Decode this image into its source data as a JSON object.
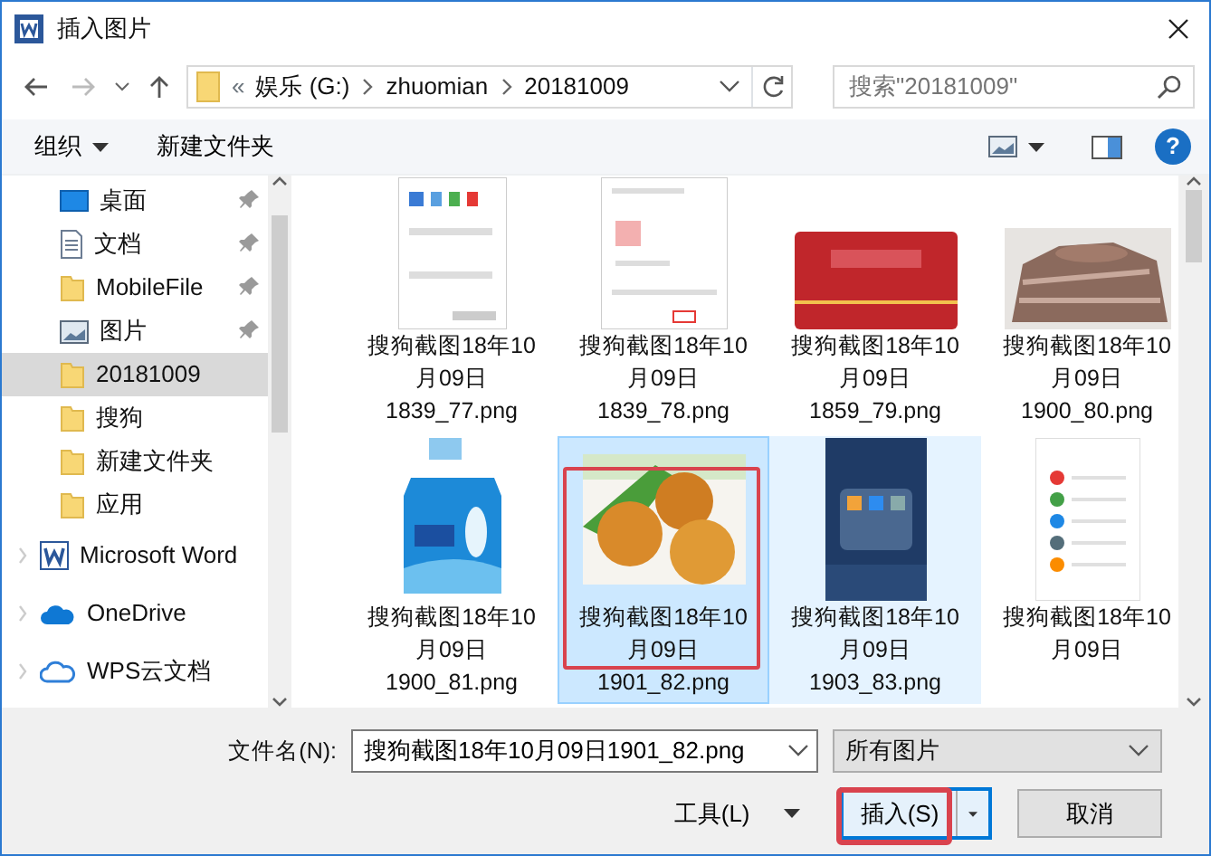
{
  "window": {
    "title": "插入图片"
  },
  "address_bar": {
    "overflow": "«",
    "crumbs": [
      "娱乐 (G:)",
      "zhuomian",
      "20181009"
    ]
  },
  "nav": {
    "back_disabled": false,
    "forward_disabled": true
  },
  "search": {
    "placeholder": "搜索\"20181009\""
  },
  "toolbar": {
    "organize": "组织",
    "new_folder": "新建文件夹",
    "help": "?"
  },
  "sidebar": {
    "items": [
      {
        "label": "桌面",
        "kind": "desktop",
        "pinned": true,
        "selected": false
      },
      {
        "label": "文档",
        "kind": "document",
        "pinned": true,
        "selected": false
      },
      {
        "label": "MobileFile",
        "kind": "folder",
        "pinned": true,
        "selected": false
      },
      {
        "label": "图片",
        "kind": "pictures",
        "pinned": true,
        "selected": false
      },
      {
        "label": "20181009",
        "kind": "folder",
        "pinned": false,
        "selected": true
      },
      {
        "label": "搜狗",
        "kind": "folder",
        "pinned": false,
        "selected": false
      },
      {
        "label": "新建文件夹",
        "kind": "folder",
        "pinned": false,
        "selected": false
      },
      {
        "label": "应用",
        "kind": "folder",
        "pinned": false,
        "selected": false
      }
    ],
    "roots": [
      {
        "label": "Microsoft Word",
        "kind": "word",
        "expanded": false
      },
      {
        "label": "OneDrive",
        "kind": "cloud",
        "expanded": false
      },
      {
        "label": "WPS云文档",
        "kind": "cloud-outline",
        "expanded": false
      }
    ]
  },
  "files": [
    {
      "lines": [
        "搜狗截图18年10",
        "月09日",
        "1839_77.png"
      ],
      "selected": false,
      "hovered": false,
      "highlighted": false
    },
    {
      "lines": [
        "搜狗截图18年10",
        "月09日",
        "1839_78.png"
      ],
      "selected": false,
      "hovered": false,
      "highlighted": false
    },
    {
      "lines": [
        "搜狗截图18年10",
        "月09日",
        "1859_79.png"
      ],
      "selected": false,
      "hovered": false,
      "highlighted": false
    },
    {
      "lines": [
        "搜狗截图18年10",
        "月09日",
        "1900_80.png"
      ],
      "selected": false,
      "hovered": false,
      "highlighted": false
    },
    {
      "lines": [
        "搜狗截图18年10",
        "月09日",
        "1900_81.png"
      ],
      "selected": false,
      "hovered": false,
      "highlighted": false
    },
    {
      "lines": [
        "搜狗截图18年10",
        "月09日",
        "1901_82.png"
      ],
      "selected": true,
      "hovered": false,
      "highlighted": true
    },
    {
      "lines": [
        "搜狗截图18年10",
        "月09日",
        "1903_83.png"
      ],
      "selected": false,
      "hovered": true,
      "highlighted": false
    },
    {
      "lines": [
        "搜狗截图18年10",
        "月09日"
      ],
      "selected": false,
      "hovered": false,
      "highlighted": false
    }
  ],
  "footer": {
    "filename_label": "文件名(N):",
    "filename": "搜狗截图18年10月09日1901_82.png",
    "filetype": "所有图片",
    "tools": "工具(L)",
    "insert": "插入(S)",
    "insert_highlighted": true,
    "cancel": "取消"
  }
}
